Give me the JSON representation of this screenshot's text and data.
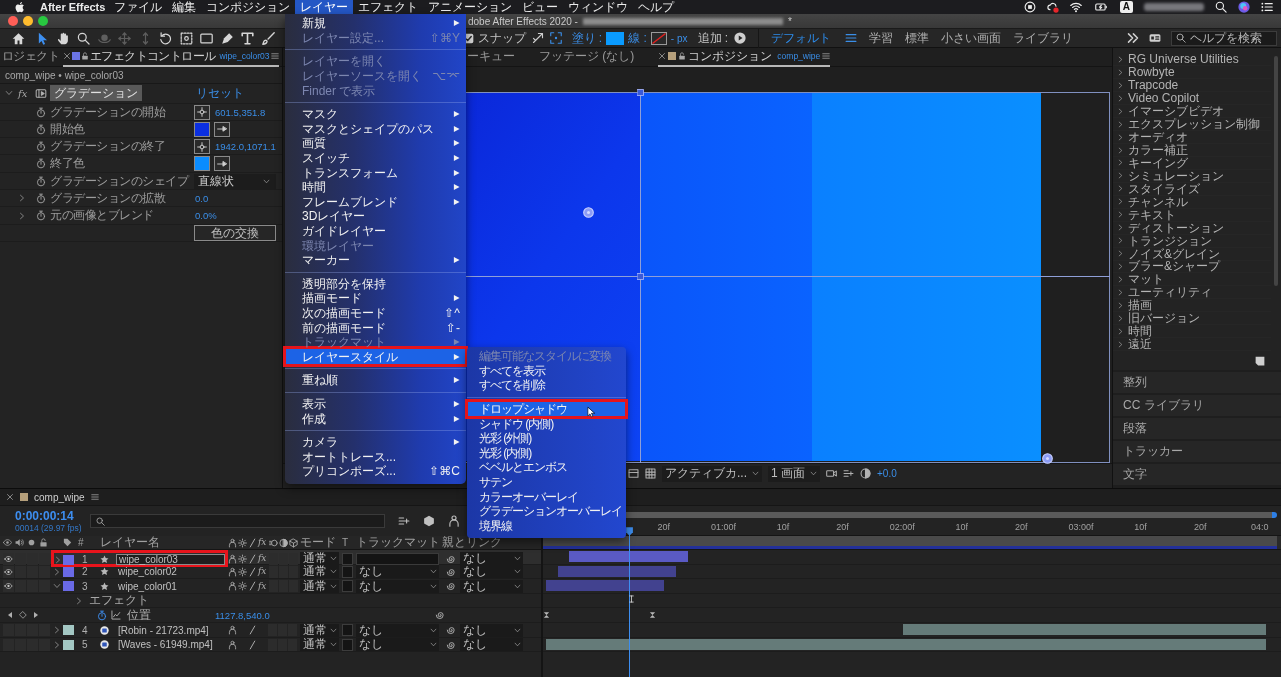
{
  "menubar": {
    "app": "After Effects",
    "items": [
      {
        "label": "ファイル",
        "selected": false
      },
      {
        "label": "編集",
        "selected": false
      },
      {
        "label": "コンポジション",
        "selected": false
      },
      {
        "label": "レイヤー",
        "selected": true
      },
      {
        "label": "エフェクト",
        "selected": false
      },
      {
        "label": "アニメーション",
        "selected": false
      },
      {
        "label": "ビュー",
        "selected": false
      },
      {
        "label": "ウィンドウ",
        "selected": false
      },
      {
        "label": "ヘルプ",
        "selected": false
      }
    ],
    "input_source": "A"
  },
  "window": {
    "title": "dobe After Effects 2020 -",
    "title_end": "*"
  },
  "toolbar": {
    "tools": [
      {
        "selected": true,
        "disabled": false
      },
      {
        "selected": false,
        "disabled": false
      },
      {
        "selected": false,
        "disabled": false
      },
      {
        "selected": false,
        "disabled": true
      },
      {
        "selected": false,
        "disabled": true
      },
      {
        "selected": false,
        "disabled": true
      },
      {
        "selected": false,
        "disabled": false
      },
      {
        "selected": false,
        "disabled": false
      },
      {
        "selected": false,
        "disabled": false
      },
      {
        "selected": false,
        "disabled": false
      },
      {
        "selected": false,
        "disabled": false
      },
      {
        "selected": false,
        "disabled": false
      }
    ],
    "snap": {
      "label": "スナップ",
      "checked": true
    },
    "fill_label": "塗り :",
    "stroke_label": "線 :",
    "stroke_width": "- px",
    "add_label": "追加 :",
    "workspaces": [
      {
        "label": "デフォルト",
        "selected": true
      },
      {
        "label": "学習",
        "selected": false
      },
      {
        "label": "標準",
        "selected": false
      },
      {
        "label": "小さい画面",
        "selected": false
      },
      {
        "label": "ライブラリ",
        "selected": false
      }
    ],
    "search": {
      "placeholder": "ヘルプを検索"
    }
  },
  "effect_controls": {
    "tabs": [
      {
        "label": "ロジェクト",
        "selected": false
      },
      {
        "label": "エフェクトコントロール",
        "layer": "wipe_color03",
        "color": "#6b74e4",
        "selected": true
      }
    ],
    "breadcrumb": "comp_wipe • wipe_color03",
    "effect": {
      "fx": "fx",
      "name": "グラデーション",
      "reset": "リセット",
      "expanded": true
    },
    "params": [
      {
        "kind": "point",
        "label": "グラデーションの開始",
        "value": "601.5,351.8"
      },
      {
        "kind": "color",
        "label": "開始色",
        "color": "#0b2fe0"
      },
      {
        "kind": "point",
        "label": "グラデーションの終了",
        "value": "1942.0,1071.1"
      },
      {
        "kind": "color",
        "label": "終了色",
        "color": "#0a8cff"
      },
      {
        "kind": "dropdown",
        "label": "グラデーションのシェイプ",
        "value": "直線状"
      },
      {
        "kind": "number",
        "label": "グラデーションの拡散",
        "value": "0.0",
        "expanded": false
      },
      {
        "kind": "number",
        "label": "元の画像とブレンド",
        "value": "0.0%",
        "expanded": false
      },
      {
        "kind": "button",
        "label": "色の交換"
      }
    ]
  },
  "composition": {
    "tabs": [
      {
        "label": "ーキュー",
        "selected": false
      },
      {
        "label": "フッテージ (なし)",
        "selected": false
      },
      {
        "label": "コンポジション",
        "comp": "comp_wipe",
        "color": "#b59f7b",
        "selected": true
      }
    ],
    "viewer_bar": {
      "camera": "アクティブカ...",
      "views": "1 画面",
      "exposure": "+0.0"
    }
  },
  "effects_presets": {
    "items": [
      "RG Universe Utilities",
      "Rowbyte",
      "Trapcode",
      "Video Copilot",
      "イマーシブビデオ",
      "エクスプレッション制御",
      "オーディオ",
      "カラー補正",
      "キーイング",
      "シミュレーション",
      "スタイライズ",
      "チャンネル",
      "テキスト",
      "ディストーション",
      "トランジション",
      "ノイズ&グレイン",
      "ブラー&シャープ",
      "マット",
      "ユーティリティ",
      "描画",
      "旧バージョン",
      "時間",
      "遠近"
    ],
    "panels": [
      "整列",
      "CC ライブラリ",
      "段落",
      "トラッカー",
      "文字"
    ]
  },
  "timeline": {
    "tab": {
      "label": "comp_wipe",
      "color": "#b59f7b"
    },
    "timecode": "0:00:00:14",
    "frame_info": "00014 (29.97 fps)",
    "ruler": [
      "20f",
      "01:00f",
      "10f",
      "20f",
      "02:00f",
      "10f",
      "20f",
      "03:00f",
      "10f",
      "20f",
      "04:0"
    ],
    "columns": {
      "number": "#",
      "name": "レイヤー名",
      "effect": "fx",
      "mode": "モード",
      "preserve": "T",
      "track_matte": "トラックマット",
      "parent": "親とリンク"
    },
    "layers": [
      {
        "number": "1",
        "name": "wipe_color03",
        "kind": "shape",
        "color": "#6a6ae6",
        "visible": true,
        "expanded": false,
        "selected": true,
        "effect_switch": "fx",
        "mode": "通常",
        "parent": "なし"
      },
      {
        "number": "2",
        "name": "wipe_color02",
        "kind": "shape",
        "color": "#6a6ae6",
        "visible": true,
        "expanded": false,
        "selected": false,
        "effect_switch": "fx",
        "mode": "通常",
        "track_matte": "なし",
        "parent": "なし"
      },
      {
        "number": "3",
        "name": "wipe_color01",
        "kind": "shape",
        "color": "#6a6ae6",
        "visible": true,
        "expanded": true,
        "selected": false,
        "effect_switch": "fx",
        "mode": "通常",
        "track_matte": "なし",
        "parent": "なし",
        "children": [
          {
            "kind": "group",
            "label": "エフェクト",
            "expanded": false
          },
          {
            "kind": "property",
            "label": "位置",
            "value": "1127.8,540.0"
          }
        ]
      },
      {
        "number": "4",
        "name": "[Robin - 21723.mp4]",
        "kind": "footage",
        "color": "#a3c7c3",
        "visible": false,
        "expanded": false,
        "selected": false,
        "mode": "通常",
        "track_matte": "なし",
        "parent": "なし"
      },
      {
        "number": "5",
        "name": "[Waves - 61949.mp4]",
        "kind": "footage",
        "color": "#a3c7c3",
        "visible": false,
        "expanded": false,
        "selected": false,
        "mode": "通常",
        "track_matte": "なし",
        "parent": "なし"
      }
    ]
  },
  "layer_menu": {
    "groups": [
      [
        {
          "label": "新規",
          "submenu": true,
          "disabled": false,
          "selected": false
        },
        {
          "label": "レイヤー設定...",
          "shortcut": "⇧⌘Y",
          "submenu": false,
          "disabled": true,
          "selected": false
        }
      ],
      [
        {
          "label": "レイヤーを開く",
          "submenu": false,
          "disabled": true,
          "selected": false
        },
        {
          "label": "レイヤーソースを開く",
          "shortcut": "⌥⌤",
          "submenu": false,
          "disabled": true,
          "selected": false
        },
        {
          "label": "Finder で表示",
          "submenu": false,
          "disabled": true,
          "selected": false
        }
      ],
      [
        {
          "label": "マスク",
          "submenu": true,
          "disabled": false,
          "selected": false
        },
        {
          "label": "マスクとシェイプのパス",
          "submenu": true,
          "disabled": false,
          "selected": false
        },
        {
          "label": "画質",
          "submenu": true,
          "disabled": false,
          "selected": false
        },
        {
          "label": "スイッチ",
          "submenu": true,
          "disabled": false,
          "selected": false
        },
        {
          "label": "トランスフォーム",
          "submenu": true,
          "disabled": false,
          "selected": false
        },
        {
          "label": "時間",
          "submenu": true,
          "disabled": false,
          "selected": false
        },
        {
          "label": "フレームブレンド",
          "submenu": true,
          "disabled": false,
          "selected": false
        },
        {
          "label": "3Dレイヤー",
          "submenu": false,
          "disabled": false,
          "selected": false
        },
        {
          "label": "ガイドレイヤー",
          "submenu": false,
          "disabled": false,
          "selected": false
        },
        {
          "label": "環境レイヤー",
          "submenu": false,
          "disabled": true,
          "selected": false
        },
        {
          "label": "マーカー",
          "submenu": true,
          "disabled": false,
          "selected": false
        }
      ],
      [
        {
          "label": "透明部分を保持",
          "submenu": false,
          "disabled": false,
          "selected": false
        },
        {
          "label": "描画モード",
          "submenu": true,
          "disabled": false,
          "selected": false
        },
        {
          "label": "次の描画モード",
          "shortcut": "⇧^",
          "submenu": false,
          "disabled": false,
          "selected": false
        },
        {
          "label": "前の描画モード",
          "shortcut": "⇧-",
          "submenu": false,
          "disabled": false,
          "selected": false
        },
        {
          "label": "トラックマット",
          "submenu": true,
          "disabled": true,
          "selected": false
        },
        {
          "label": "レイヤースタイル",
          "submenu": true,
          "disabled": false,
          "selected": true
        }
      ],
      [
        {
          "label": "重ね順",
          "submenu": true,
          "disabled": false,
          "selected": false
        }
      ],
      [
        {
          "label": "表示",
          "submenu": true,
          "disabled": false,
          "selected": false
        },
        {
          "label": "作成",
          "submenu": true,
          "disabled": false,
          "selected": false
        }
      ],
      [
        {
          "label": "カメラ",
          "submenu": true,
          "disabled": false,
          "selected": false
        },
        {
          "label": "オートトレース...",
          "submenu": false,
          "disabled": false,
          "selected": false
        },
        {
          "label": "プリコンポーズ...",
          "shortcut": "⇧⌘C",
          "submenu": false,
          "disabled": false,
          "selected": false
        }
      ]
    ]
  },
  "layer_style_menu": {
    "groups": [
      [
        {
          "label": "編集可能なスタイルに変換",
          "disabled": true,
          "selected": false
        },
        {
          "label": "すべてを表示",
          "disabled": false,
          "selected": false
        },
        {
          "label": "すべてを削除",
          "disabled": false,
          "selected": false
        }
      ],
      [
        {
          "label": "ドロップシャドウ",
          "disabled": false,
          "selected": true
        },
        {
          "label": "シャドウ (内側)",
          "disabled": false,
          "selected": false
        },
        {
          "label": "光彩 (外側)",
          "disabled": false,
          "selected": false
        },
        {
          "label": "光彩 (内側)",
          "disabled": false,
          "selected": false
        },
        {
          "label": "ベベルとエンボス",
          "disabled": false,
          "selected": false
        },
        {
          "label": "サテン",
          "disabled": false,
          "selected": false
        },
        {
          "label": "カラーオーバーレイ",
          "disabled": false,
          "selected": false
        },
        {
          "label": "グラデーションオーバーレイ",
          "disabled": false,
          "selected": false
        },
        {
          "label": "境界線",
          "disabled": false,
          "selected": false
        }
      ]
    ]
  }
}
